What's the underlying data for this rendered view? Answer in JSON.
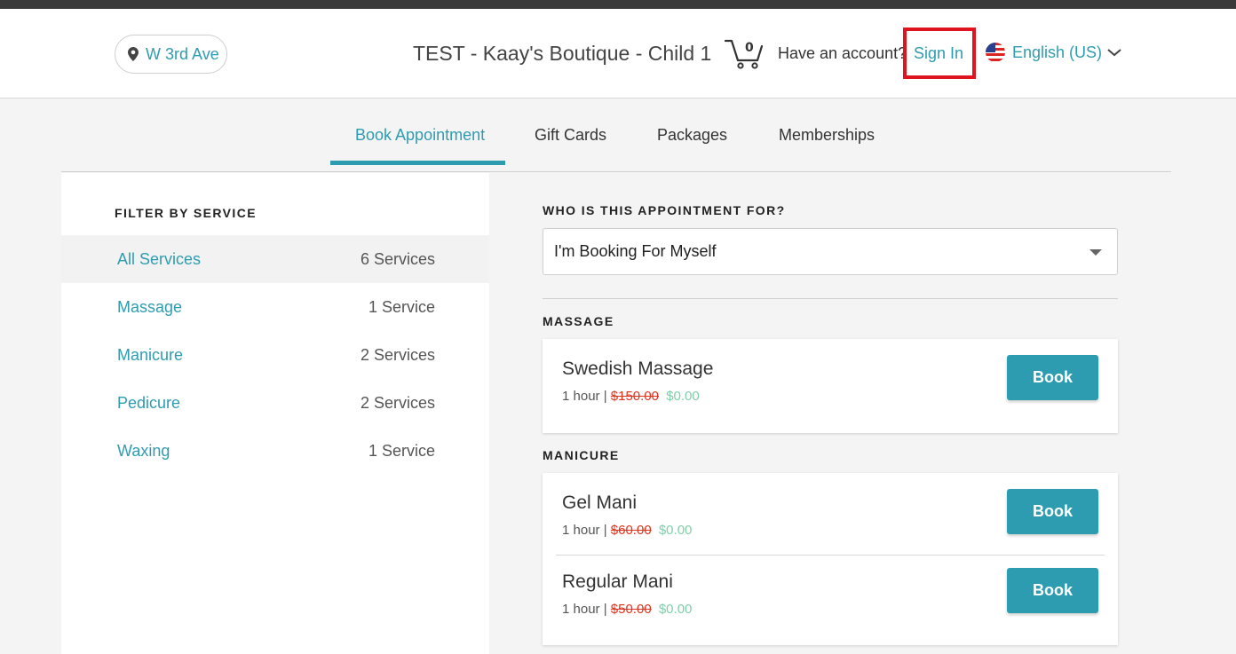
{
  "header": {
    "location": "W 3rd Ave",
    "store_title": "TEST - Kaay's Boutique - Child 1",
    "cart_count": "0",
    "have_account": "Have an account?",
    "sign_in": "Sign In",
    "language": "English (US)"
  },
  "tabs": [
    {
      "label": "Book Appointment",
      "active": true
    },
    {
      "label": "Gift Cards"
    },
    {
      "label": "Packages"
    },
    {
      "label": "Memberships"
    }
  ],
  "sidebar": {
    "title": "FILTER BY SERVICE",
    "items": [
      {
        "name": "All Services",
        "count": "6 Services",
        "selected": true
      },
      {
        "name": "Massage",
        "count": "1 Service"
      },
      {
        "name": "Manicure",
        "count": "2 Services"
      },
      {
        "name": "Pedicure",
        "count": "2 Services"
      },
      {
        "name": "Waxing",
        "count": "1 Service"
      }
    ]
  },
  "main": {
    "who_label": "WHO IS THIS APPOINTMENT FOR?",
    "who_value": "I'm Booking For Myself",
    "sections": [
      {
        "title": "MASSAGE",
        "services": [
          {
            "name": "Swedish Massage",
            "duration": "1 hour |",
            "old_price": "$150.00",
            "new_price": "$0.00",
            "button": "Book"
          }
        ]
      },
      {
        "title": "MANICURE",
        "services": [
          {
            "name": "Gel Mani",
            "duration": "1 hour |",
            "old_price": "$60.00",
            "new_price": "$0.00",
            "button": "Book"
          },
          {
            "name": "Regular Mani",
            "duration": "1 hour |",
            "old_price": "$50.00",
            "new_price": "$0.00",
            "button": "Book"
          }
        ]
      }
    ]
  },
  "colors": {
    "accent": "#2e9cb0",
    "highlight_box": "#e0141e",
    "old_price": "#e0341e",
    "new_price": "#7fcfa8"
  }
}
